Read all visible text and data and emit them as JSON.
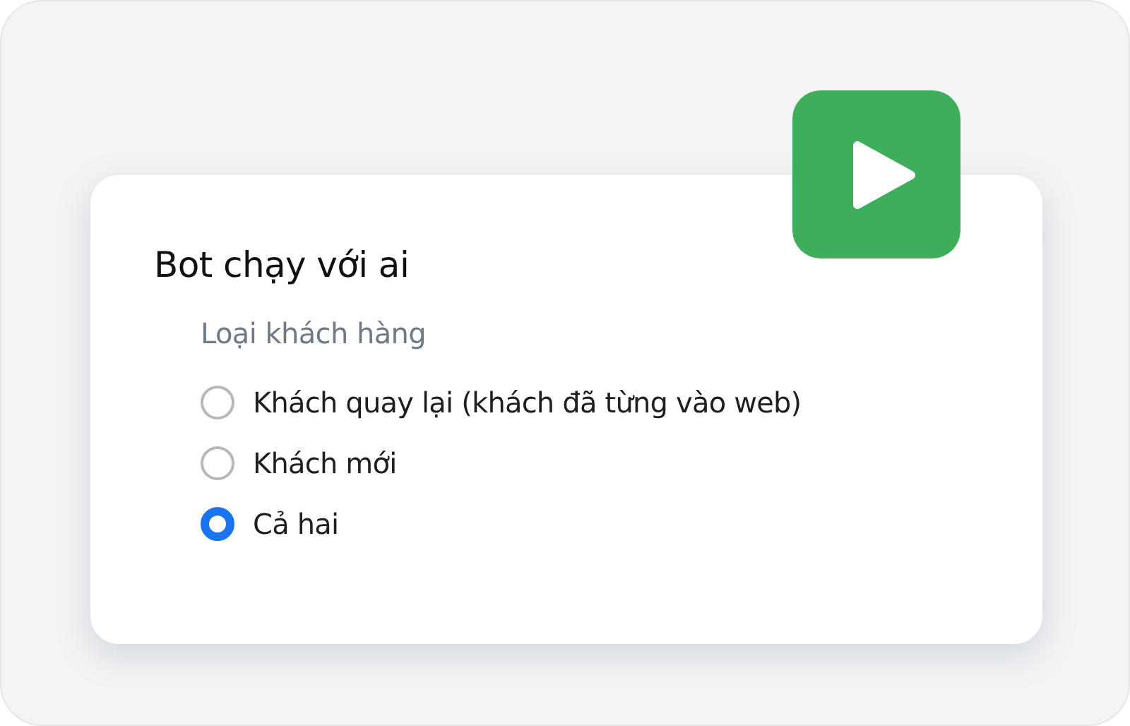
{
  "card": {
    "title": "Bot chạy với ai",
    "field_label": "Loại khách hàng",
    "options": [
      {
        "label": "Khách quay lại (khách đã từng vào web)",
        "selected": false
      },
      {
        "label": "Khách mới",
        "selected": false
      },
      {
        "label": "Cả hai",
        "selected": true
      }
    ]
  }
}
